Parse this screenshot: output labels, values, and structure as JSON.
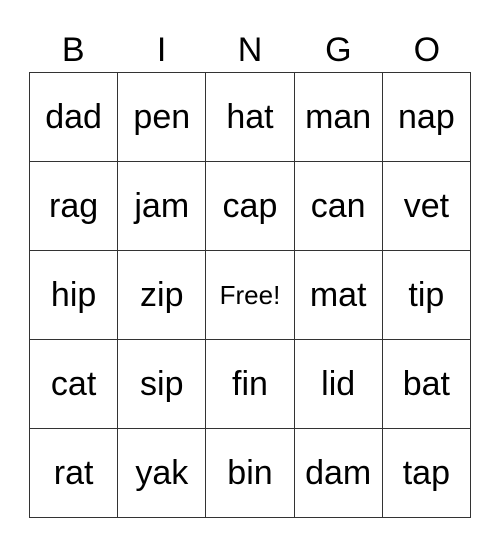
{
  "header": [
    "B",
    "I",
    "N",
    "G",
    "O"
  ],
  "rows": [
    [
      "dad",
      "pen",
      "hat",
      "man",
      "nap"
    ],
    [
      "rag",
      "jam",
      "cap",
      "can",
      "vet"
    ],
    [
      "hip",
      "zip",
      "Free!",
      "mat",
      "tip"
    ],
    [
      "cat",
      "sip",
      "fin",
      "lid",
      "bat"
    ],
    [
      "rat",
      "yak",
      "bin",
      "dam",
      "tap"
    ]
  ]
}
